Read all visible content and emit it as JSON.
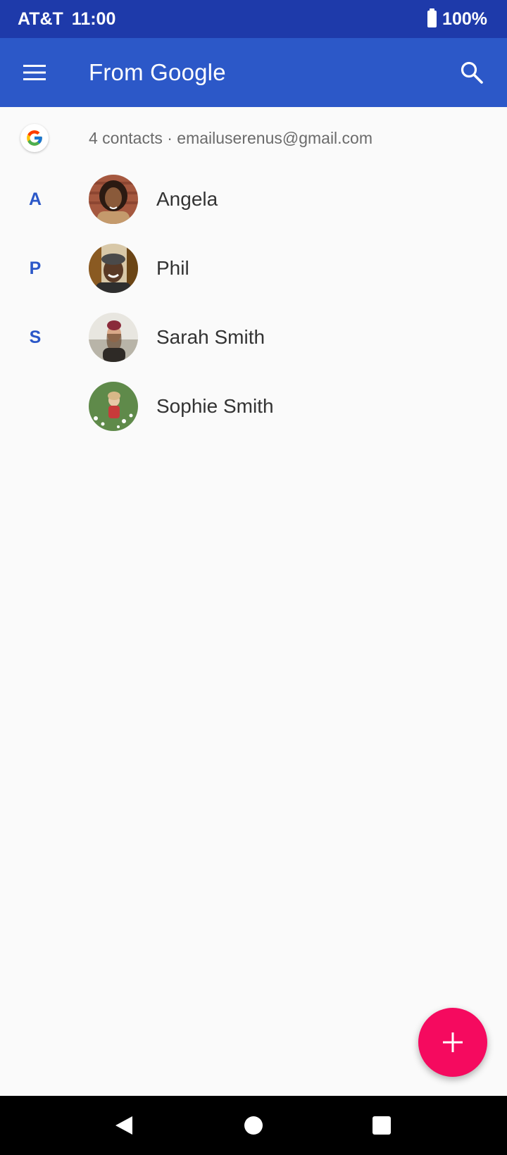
{
  "status_bar": {
    "carrier": "AT&T",
    "time": "11:00",
    "battery": "100%"
  },
  "app_bar": {
    "title": "From Google",
    "menu_icon": "hamburger-menu-icon",
    "search_icon": "search-icon"
  },
  "account": {
    "icon": "google-logo-icon",
    "summary": "4 contacts · emailuserenus@gmail.com"
  },
  "contacts": [
    {
      "letter": "A",
      "name": "Angela"
    },
    {
      "letter": "P",
      "name": "Phil"
    },
    {
      "letter": "S",
      "name": "Sarah Smith"
    },
    {
      "letter": "",
      "name": "Sophie Smith"
    }
  ],
  "fab": {
    "icon": "plus-icon"
  },
  "nav": {
    "back_icon": "back-triangle-icon",
    "home_icon": "home-circle-icon",
    "recents_icon": "recents-square-icon"
  },
  "colors": {
    "status_bar": "#1e3aaa",
    "app_bar": "#2c58c8",
    "accent_letter": "#2c58c8",
    "fab": "#f50a5f"
  }
}
